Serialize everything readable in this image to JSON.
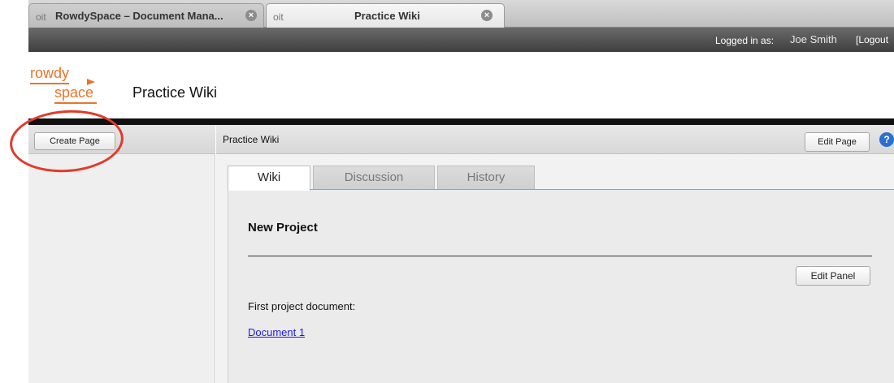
{
  "browser": {
    "tabs": [
      {
        "favicon": "oit",
        "label": "RowdySpace – Document Mana...",
        "close": "×"
      },
      {
        "favicon": "oit",
        "label": "Practice Wiki",
        "close": "×"
      }
    ]
  },
  "userbar": {
    "logged_in_label": "Logged in as:",
    "user_name": "Joe Smith",
    "logout_label": "[Logout"
  },
  "header": {
    "logo_line1": "rowdy",
    "logo_line2": "space",
    "site_title": "Practice Wiki"
  },
  "sidebar": {
    "create_page_label": "Create Page"
  },
  "main": {
    "breadcrumb": "Practice Wiki",
    "edit_page_label": "Edit Page",
    "help_glyph": "?",
    "tabs": [
      {
        "label": "Wiki"
      },
      {
        "label": "Discussion"
      },
      {
        "label": "History"
      }
    ],
    "panel": {
      "title": "New Project",
      "edit_panel_label": "Edit Panel",
      "text": "First project document:",
      "link": "Document 1"
    }
  },
  "colors": {
    "brand_orange": "#e8742a",
    "annotation_red": "#e23a2a",
    "link_blue": "#1a1aee"
  }
}
